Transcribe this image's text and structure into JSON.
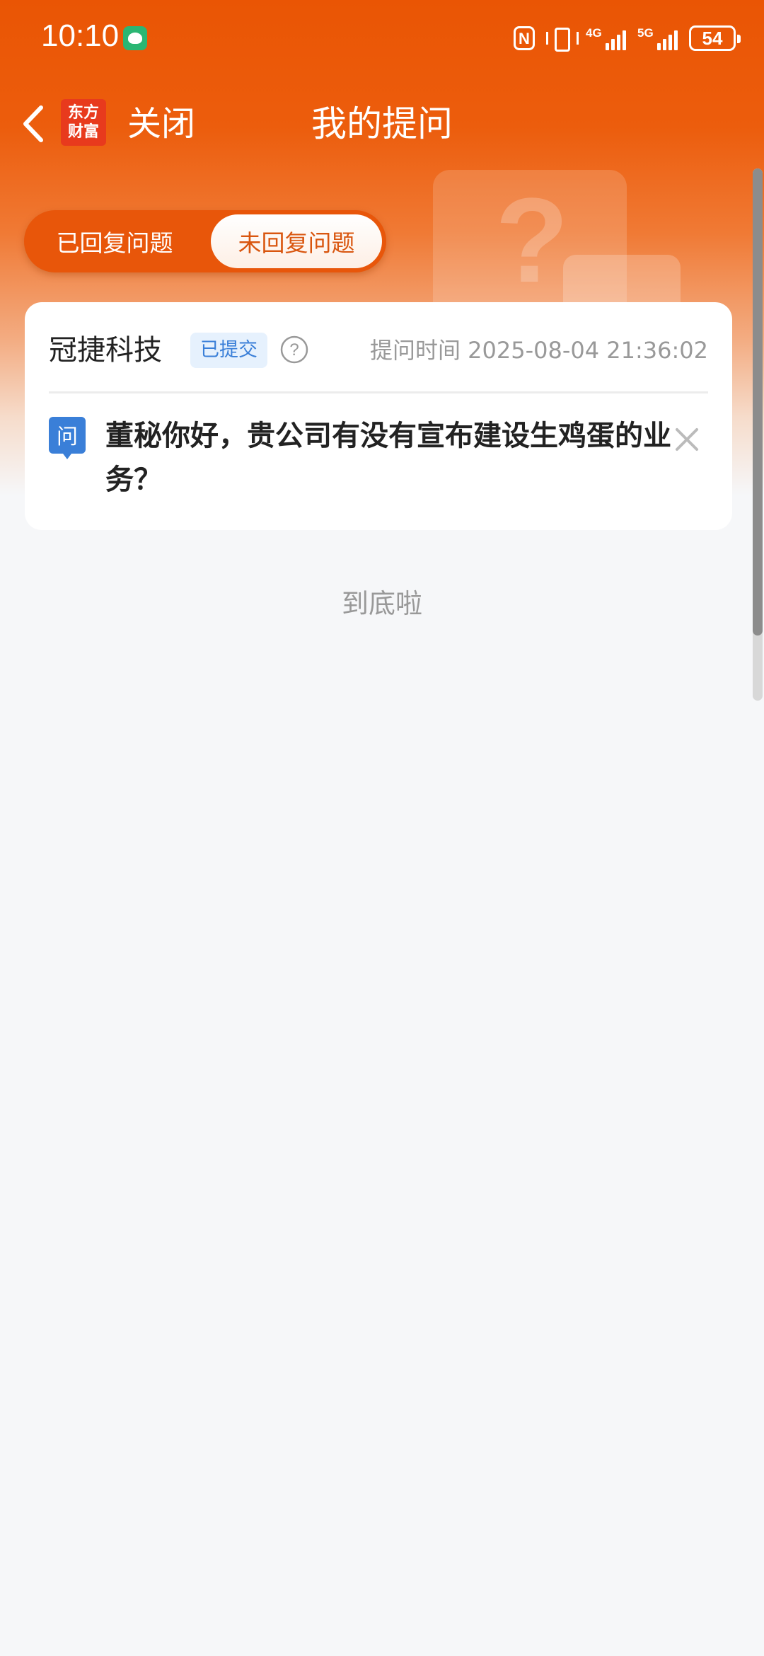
{
  "status_bar": {
    "time": "10:10",
    "signal1_label": "4G",
    "signal2_label": "5G",
    "battery": "54"
  },
  "nav": {
    "logo_line1": "东方",
    "logo_line2": "财富",
    "close_label": "关闭",
    "title": "我的提问"
  },
  "tabs": {
    "answered": "已回复问题",
    "unanswered": "未回复问题",
    "active": "unanswered"
  },
  "questions": [
    {
      "company": "冠捷科技",
      "status": "已提交",
      "ask_time": "提问时间 2025-08-04 21:36:02",
      "q_marker": "问",
      "text": "董秘你好，贵公司有没有宣布建设生鸡蛋的业务？"
    }
  ],
  "end_text": "到底啦",
  "colors": {
    "brand_orange": "#ea5504",
    "active_tab_text": "#d9560f",
    "badge_blue": "#3a7fd8",
    "question_marker_blue": "#3a7fd8"
  }
}
